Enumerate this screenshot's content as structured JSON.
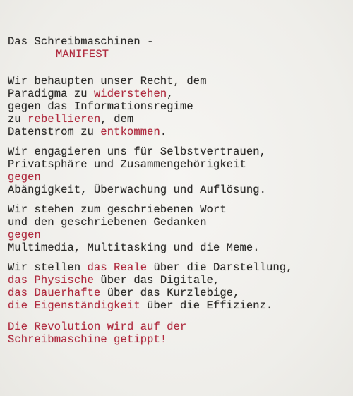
{
  "title": {
    "line1": "Das Schreibmaschinen -",
    "line2": "MANIFEST"
  },
  "paragraphs": [
    {
      "lines": [
        [
          {
            "t": "Wir behaupten unser Recht, dem"
          }
        ],
        [
          {
            "t": "Paradigma zu "
          },
          {
            "t": "widerstehen",
            "red": true
          },
          {
            "t": ","
          }
        ],
        [
          {
            "t": "gegen das Informationsregime"
          }
        ],
        [
          {
            "t": "zu "
          },
          {
            "t": "rebellieren",
            "red": true
          },
          {
            "t": ", dem"
          }
        ],
        [
          {
            "t": "Datenstrom zu "
          },
          {
            "t": "entkommen",
            "red": true
          },
          {
            "t": "."
          }
        ]
      ]
    },
    {
      "lines": [
        [
          {
            "t": "Wir engagieren uns für Selbstvertrauen,"
          }
        ],
        [
          {
            "t": "Privatsphäre und Zusammengehörigkeit"
          }
        ],
        [
          {
            "t": "gegen",
            "red": true
          }
        ],
        [
          {
            "t": "Abängigkeit, Überwachung und Auflösung."
          }
        ]
      ]
    },
    {
      "lines": [
        [
          {
            "t": "Wir stehen zum geschriebenen Wort"
          }
        ],
        [
          {
            "t": "und den geschriebenen Gedanken"
          }
        ],
        [
          {
            "t": "gegen",
            "red": true
          }
        ],
        [
          {
            "t": "Multimedia, Multitasking und die Meme."
          }
        ]
      ]
    },
    {
      "lines": [
        [
          {
            "t": "Wir stellen "
          },
          {
            "t": "das Reale",
            "red": true
          },
          {
            "t": " über die Darstellung,"
          }
        ],
        [
          {
            "t": "das Physische",
            "red": true
          },
          {
            "t": " über das Digitale,"
          }
        ],
        [
          {
            "t": "das Dauerhafte",
            "red": true
          },
          {
            "t": " über das Kurzlebige,"
          }
        ],
        [
          {
            "t": "die Eigenständigkeit",
            "red": true
          },
          {
            "t": " über die Effizienz."
          }
        ]
      ]
    },
    {
      "lines": [
        [
          {
            "t": "Die Revolution wird auf der",
            "red": true
          }
        ],
        [
          {
            "t": "Schreibmaschine getippt!",
            "red": true
          }
        ]
      ]
    }
  ],
  "colors": {
    "ink_black": "#2b2a28",
    "ink_red": "#b02a3e",
    "paper": "#f3f2ef"
  }
}
